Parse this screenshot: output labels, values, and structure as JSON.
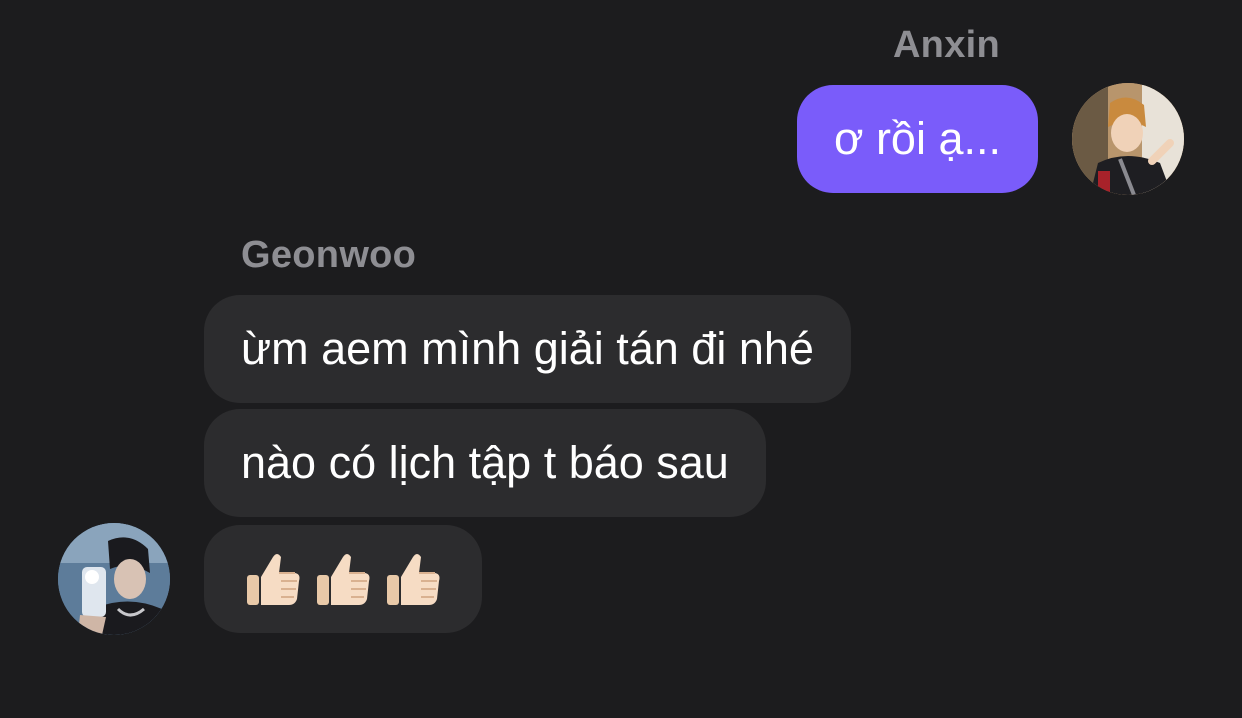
{
  "messages": {
    "outgoing": {
      "sender": "Anxin",
      "text": "ơ rồi ạ..."
    },
    "incoming": {
      "sender": "Geonwoo",
      "texts": [
        "ừm aem mình giải tán đi nhé",
        "nào có lịch tập t báo sau"
      ],
      "reaction_emoji": [
        "thumbs-up-icon",
        "thumbs-up-icon",
        "thumbs-up-icon"
      ]
    }
  },
  "colors": {
    "background": "#1c1c1e",
    "outgoing_bubble": "#7a5cfa",
    "incoming_bubble": "#2c2c2e",
    "sender_name": "#8e8e93"
  }
}
